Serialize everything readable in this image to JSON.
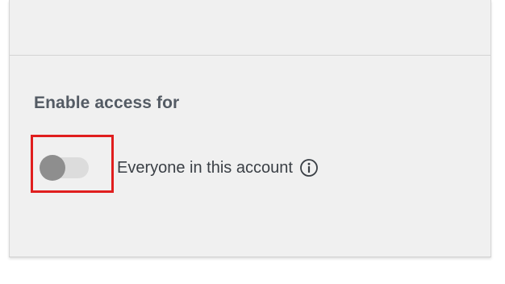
{
  "section": {
    "title": "Enable access for"
  },
  "toggle": {
    "label": "Everyone in this account",
    "state": "off",
    "info_icon": "info-icon"
  },
  "annotation": {
    "highlight_color": "#e01e1e"
  },
  "colors": {
    "card_background": "#f0f0f0",
    "toggle_track": "#dcdcdc",
    "toggle_knob": "#8e8e8e",
    "title_text": "#545b64"
  }
}
